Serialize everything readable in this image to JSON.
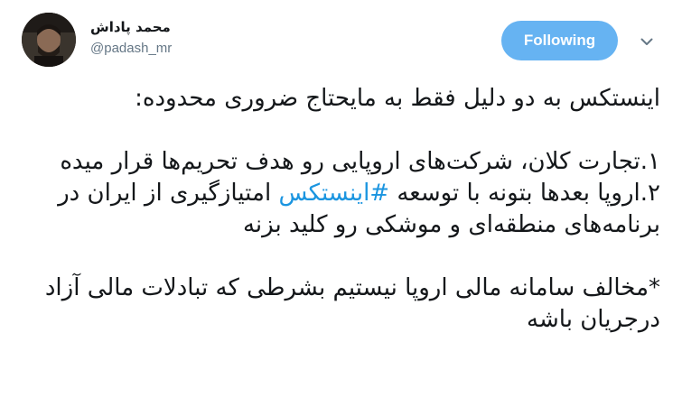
{
  "author": {
    "display_name": "محمد پاداش",
    "username": "@padash_mr"
  },
  "follow_button": {
    "label": "Following"
  },
  "menu": {
    "icon": "chevron-down-icon"
  },
  "tweet": {
    "line1": "اینستکس به دو دلیل فقط به مایحتاج ضروری محدوده:",
    "line2": "۱.تجارت کلان، شرکت‌های اروپایی رو هدف تحریم‌ها قرار میده",
    "line3_before": "۲.اروپا بعدها بتونه با توسعه ",
    "line3_hashtag": "#اینستکس",
    "line3_after": " امتیازگیری از ایران در برنامه‌های منطقه‌ای و موشکی رو کلید بزنه",
    "line4": "*مخالف سامانه مالی اروپا نیستیم بشرطی که تبادلات مالی آزاد درجریان باشه"
  },
  "colors": {
    "follow_bg": "#66b3f2",
    "hashtag": "#1b95e0",
    "username": "#657786",
    "text": "#14171a"
  }
}
